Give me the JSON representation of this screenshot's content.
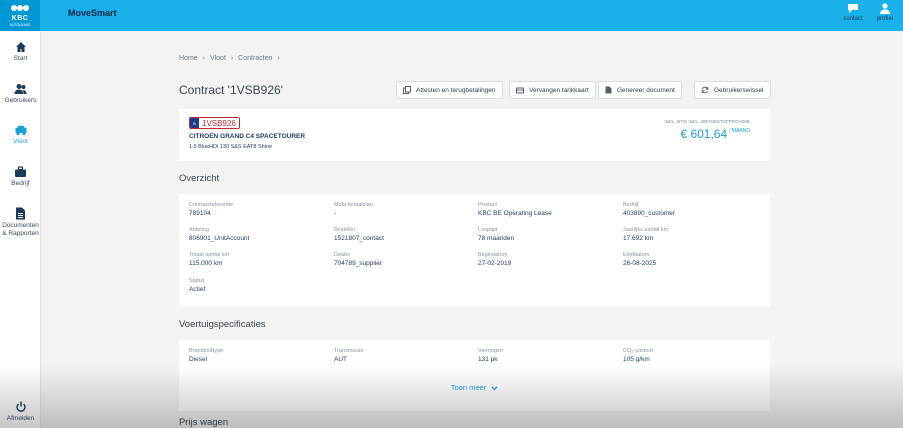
{
  "header": {
    "brand": "KBC",
    "brand_sub": "AUTOLEASE",
    "app_title": "MoveSmart",
    "contact_label": "contact",
    "profile_label": "profiel"
  },
  "sidebar": {
    "items": [
      {
        "label": "Start",
        "icon": "home-icon"
      },
      {
        "label": "Gebruikers",
        "icon": "users-icon"
      },
      {
        "label": "Vloot",
        "icon": "car-icon",
        "active": true
      },
      {
        "label": "Bedrijf",
        "icon": "briefcase-icon"
      },
      {
        "label": "Documenten",
        "label2": "& Rapporten",
        "icon": "document-icon"
      }
    ],
    "logout_label": "Afmelden"
  },
  "breadcrumb": [
    "Home",
    "›",
    "Vloot",
    "›",
    "Contracten",
    "›"
  ],
  "page_title": "Contract '1VSB926'",
  "actions": {
    "attesten": "Attesten en terugbetalingen",
    "tankkaart": "Vervangen tankkaart",
    "document": "Genereer document",
    "wissel": "Gebruikerswissel"
  },
  "vehicle": {
    "plate_country": "B",
    "plate": "1VSB926",
    "model": "CITROËN GRAND C4 SPACETOURER",
    "version": "1.5 BlueHDi 130 S&S EAT8 Shine",
    "price_label": "INCL. BTW INCL. BRANDSTOFPROVISIE",
    "price": "€ 601,64",
    "price_unit": "/ MAAND"
  },
  "overview": {
    "title": "Overzicht",
    "fields": [
      {
        "key": "Contractreferentie",
        "value": "789104"
      },
      {
        "key": "Mobi betaalplan",
        "value": "-"
      },
      {
        "key": "Product",
        "value": "KBC BE Operating Lease"
      },
      {
        "key": "Bedrijf",
        "value": "403890_customer"
      },
      {
        "key": "Afdeling",
        "value": "806901_UnitAccount"
      },
      {
        "key": "Besteller",
        "value": "1521807_contact"
      },
      {
        "key": "Looptijd",
        "value": "78 maanden"
      },
      {
        "key": "Jaarlijks aantal km",
        "value": "17.692 km"
      },
      {
        "key": "Totaal aantal km",
        "value": "115.000 km"
      },
      {
        "key": "Dealer",
        "value": "704789_supplier"
      },
      {
        "key": "Begindatum",
        "value": "27-02-2019"
      },
      {
        "key": "Einddatum",
        "value": "26-08-2025"
      },
      {
        "key": "Status",
        "value": "Actief"
      }
    ]
  },
  "specs": {
    "title": "Voertuigspecificaties",
    "fields": [
      {
        "key": "Brandstoftype",
        "value": "Diesel"
      },
      {
        "key": "Transmissie",
        "value": "AUT"
      },
      {
        "key": "Vermogen",
        "value": "131 pk"
      },
      {
        "key": "CO₂-uitstoot",
        "value": "105 g/km"
      }
    ],
    "more_label": "Toon meer"
  },
  "next_section": "Prijs wagen",
  "colors": {
    "accent": "#1ab0ea",
    "link": "#1a9fd6",
    "navy": "#1f3b5a"
  }
}
